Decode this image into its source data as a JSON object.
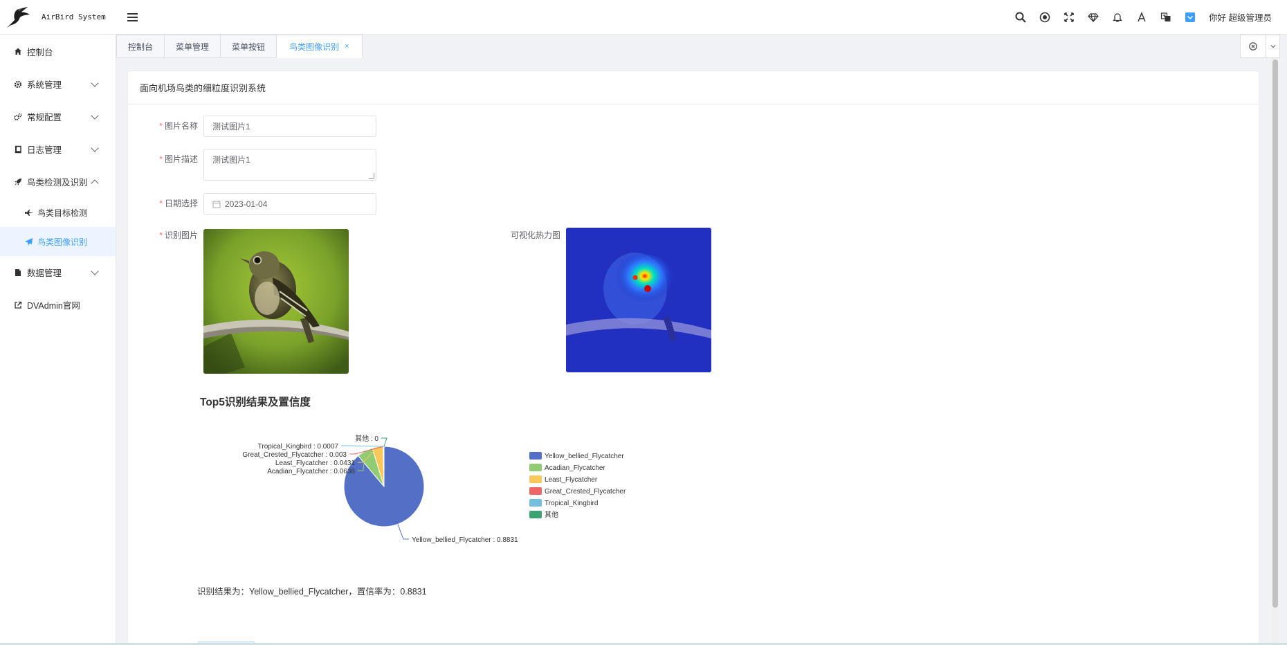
{
  "app": {
    "logo_title": "AirBird System",
    "greeting": "你好 超级管理员"
  },
  "sidebar": {
    "items": [
      {
        "label": "控制台",
        "icon": "home-icon"
      },
      {
        "label": "系统管理",
        "icon": "gear-icon"
      },
      {
        "label": "常规配置",
        "icon": "gears-icon"
      },
      {
        "label": "日志管理",
        "icon": "book-icon"
      },
      {
        "label": "鸟类检测及识别",
        "icon": "rocket-icon"
      },
      {
        "label": "鸟类目标检测",
        "icon": "fighter-jet-icon"
      },
      {
        "label": "鸟类图像识别",
        "icon": "plane-icon"
      },
      {
        "label": "数据管理",
        "icon": "file-icon"
      },
      {
        "label": "DVAdmin官网",
        "icon": "external-link-icon"
      }
    ]
  },
  "tabs": [
    {
      "label": "控制台"
    },
    {
      "label": "菜单管理"
    },
    {
      "label": "菜单按钮"
    },
    {
      "label": "鸟类图像识别",
      "close": "×"
    }
  ],
  "card": {
    "title": "面向机场鸟类的细粒度识别系统"
  },
  "form": {
    "name_label": "图片名称",
    "name_value": "测试图片1",
    "desc_label": "图片描述",
    "desc_value": "测试图片1",
    "date_label": "日期选择",
    "date_value": "2023-01-04",
    "image_label": "识别图片",
    "heatmap_label": "可视化热力图",
    "required_mark": "*"
  },
  "chart_data": {
    "type": "pie",
    "title": "Top5识别结果及置信度",
    "categories": [
      "Yellow_bellied_Flycatcher",
      "Acadian_Flycatcher",
      "Least_Flycatcher",
      "Great_Crested_Flycatcher",
      "Tropical_Kingbird",
      "其他"
    ],
    "values": [
      0.8831,
      0.0638,
      0.0431,
      0.003,
      0.0007,
      0
    ],
    "colors": [
      "#5470c6",
      "#91cc75",
      "#fac858",
      "#ee6666",
      "#73c0de",
      "#3ba272"
    ],
    "slice_labels": [
      "Yellow_bellied_Flycatcher : 0.8831",
      "Acadian_Flycatcher : 0.0638",
      "Least_Flycatcher : 0.0431",
      "Great_Crested_Flycatcher : 0.003",
      "Tropical_Kingbird : 0.0007",
      "其他 : 0"
    ],
    "legend_position": "right"
  },
  "result": {
    "text": "识别结果为：Yellow_bellied_Flycatcher，置信率为：0.8831"
  }
}
